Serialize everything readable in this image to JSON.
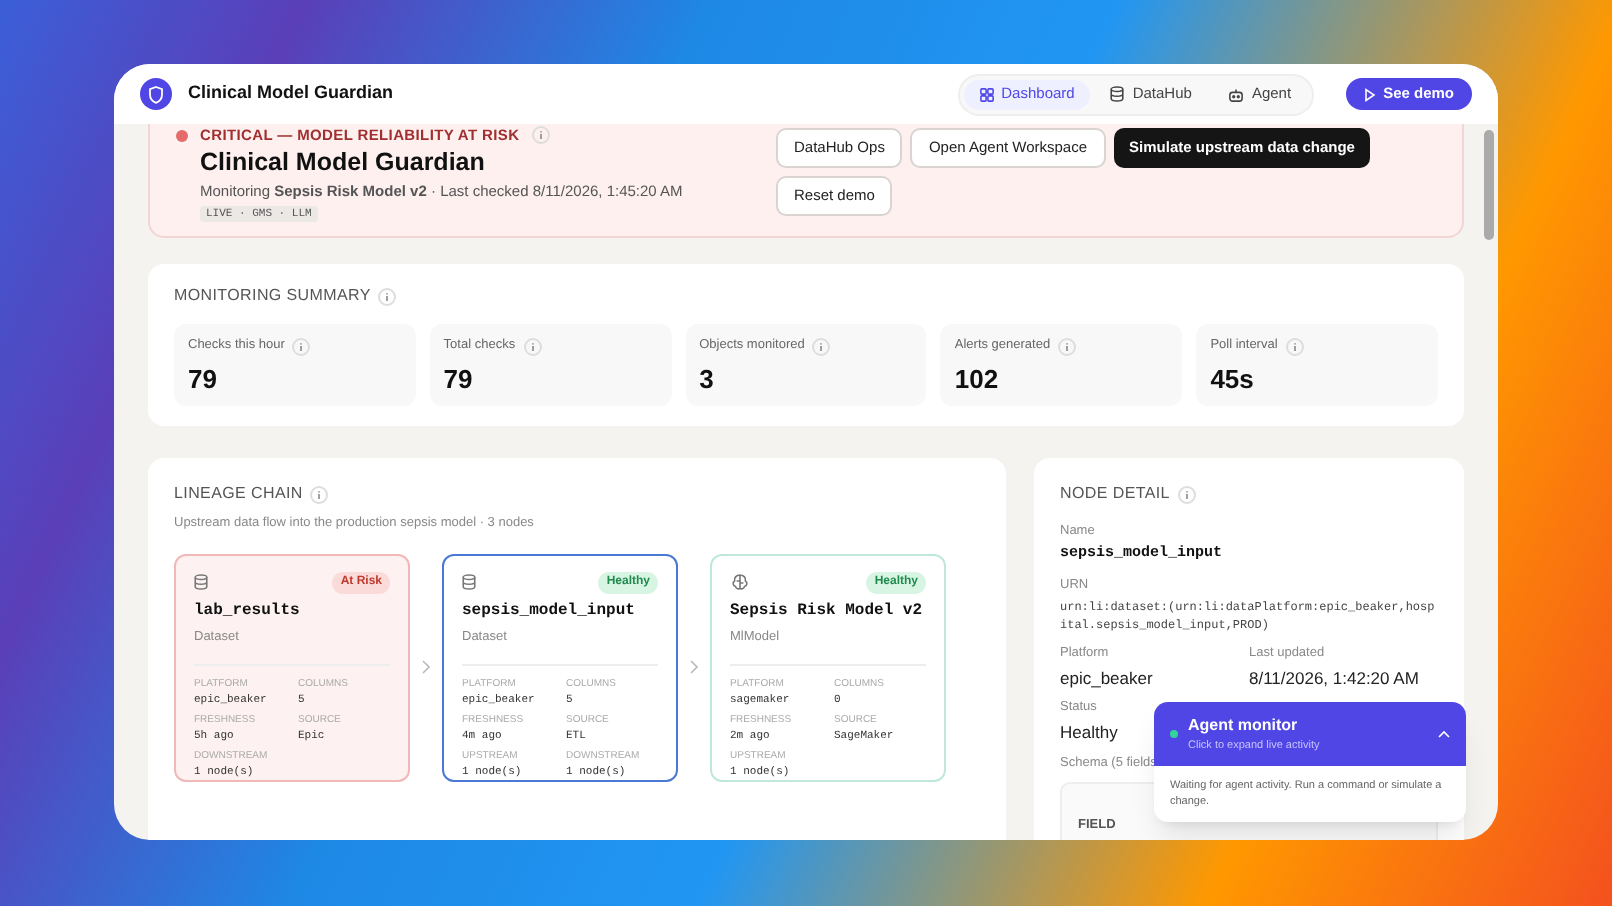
{
  "app": {
    "title": "Clinical Model Guardian"
  },
  "nav": [
    {
      "label": "Dashboard",
      "selected": true
    },
    {
      "label": "DataHub",
      "selected": false
    },
    {
      "label": "Agent",
      "selected": false
    }
  ],
  "cta": {
    "label": "See demo"
  },
  "alert": {
    "status": "CRITICAL — MODEL RELIABILITY AT RISK",
    "title": "Clinical Model Guardian",
    "monitoring": "Monitoring **Sepsis Risk Model v2** · Last checked 8/11/2026, 1:45:20 AM",
    "badge": "LIVE · GMS · LLM",
    "actions": [
      {
        "label": "DataHub Ops",
        "primary": false
      },
      {
        "label": "Open Agent Workspace",
        "primary": false
      },
      {
        "label": "Simulate upstream data change",
        "primary": true
      },
      {
        "label": "Reset demo",
        "primary": false
      }
    ]
  },
  "summary": {
    "title": "MONITORING SUMMARY",
    "stats": [
      {
        "label": "Checks this hour",
        "value": "79"
      },
      {
        "label": "Total checks",
        "value": "79"
      },
      {
        "label": "Objects monitored",
        "value": "3"
      },
      {
        "label": "Alerts generated",
        "value": "102"
      },
      {
        "label": "Poll interval",
        "value": "45s"
      }
    ]
  },
  "lineage": {
    "title": "LINEAGE CHAIN",
    "subtitle": "Upstream data flow into the production sepsis model · 3 nodes",
    "nodes": [
      {
        "name": "lab_results",
        "type": "Dataset",
        "kind": "dataset",
        "at_risk": true,
        "badge": "At Risk",
        "selected": false,
        "fields": [
          {
            "label": "PLATFORM",
            "value": "epic_beaker"
          },
          {
            "label": "COLUMNS",
            "value": "5"
          },
          {
            "label": "FRESHNESS",
            "value": "5h ago"
          },
          {
            "label": "SOURCE",
            "value": "Epic"
          },
          {
            "label": "DOWNSTREAM",
            "value": "1 node(s)"
          }
        ]
      },
      {
        "name": "sepsis_model_input",
        "type": "Dataset",
        "kind": "dataset",
        "at_risk": false,
        "badge": "Healthy",
        "selected": true,
        "fields": [
          {
            "label": "PLATFORM",
            "value": "epic_beaker"
          },
          {
            "label": "COLUMNS",
            "value": "5"
          },
          {
            "label": "FRESHNESS",
            "value": "4m ago"
          },
          {
            "label": "SOURCE",
            "value": "ETL"
          },
          {
            "label": "UPSTREAM",
            "value": "1 node(s)"
          },
          {
            "label": "DOWNSTREAM",
            "value": "1 node(s)"
          }
        ]
      },
      {
        "name": "Sepsis Risk Model v2",
        "type": "MlModel",
        "kind": "model",
        "at_risk": false,
        "badge": "Healthy",
        "selected": false,
        "fields": [
          {
            "label": "PLATFORM",
            "value": "sagemaker"
          },
          {
            "label": "COLUMNS",
            "value": "0"
          },
          {
            "label": "FRESHNESS",
            "value": "2m ago"
          },
          {
            "label": "SOURCE",
            "value": "SageMaker"
          },
          {
            "label": "UPSTREAM",
            "value": "1 node(s)"
          }
        ]
      }
    ]
  },
  "detail": {
    "title": "NODE DETAIL",
    "name_label": "Name",
    "name": "sepsis_model_input",
    "urn_label": "URN",
    "urn": "urn:li:dataset:(urn:li:dataPlatform:epic_beaker,hospital.sepsis_model_input,PROD)",
    "pairs": [
      {
        "label": "Platform",
        "value": "epic_beaker"
      },
      {
        "label": "Last updated",
        "value": "8/11/2026, 1:42:20 AM"
      },
      {
        "label": "Status",
        "value": "Healthy"
      }
    ],
    "schema_label": "Schema (5 fields",
    "schema_header": "FIELD"
  },
  "agent": {
    "title": "Agent monitor",
    "subtitle": "Click to expand live activity",
    "message": "Waiting for agent activity. Run a command or simulate a change.",
    "expanded": false
  }
}
